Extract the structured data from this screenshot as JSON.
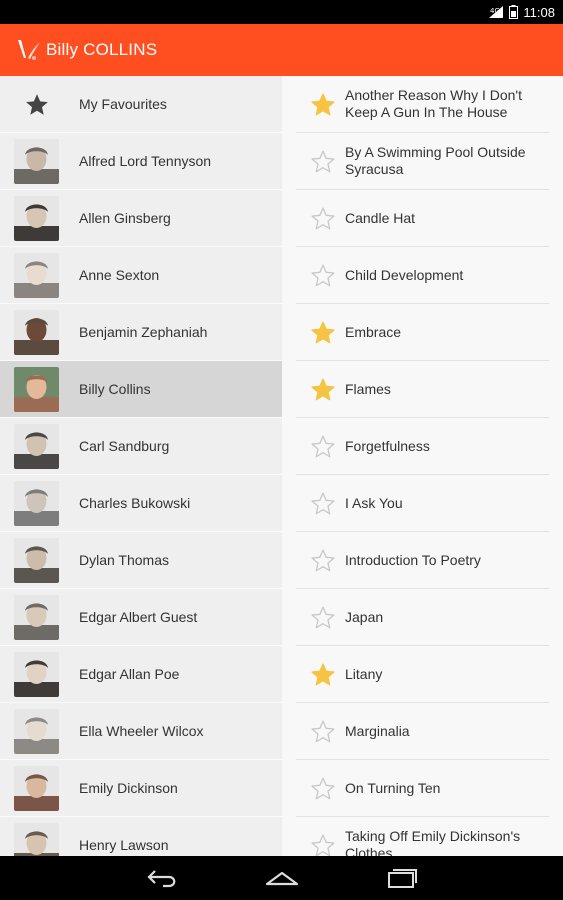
{
  "status_bar": {
    "time": "11:08"
  },
  "app_bar": {
    "title": "Billy COLLINS"
  },
  "favourites": {
    "label": "My Favourites"
  },
  "poets": [
    {
      "name": "Alfred Lord Tennyson",
      "avatar": "portrait-icon"
    },
    {
      "name": "Allen Ginsberg",
      "avatar": "portrait-icon"
    },
    {
      "name": "Anne Sexton",
      "avatar": "portrait-icon"
    },
    {
      "name": "Benjamin Zephaniah",
      "avatar": "portrait-icon"
    },
    {
      "name": "Billy Collins",
      "avatar": "portrait-icon",
      "selected": true
    },
    {
      "name": "Carl Sandburg",
      "avatar": "portrait-icon"
    },
    {
      "name": "Charles Bukowski",
      "avatar": "portrait-icon"
    },
    {
      "name": "Dylan Thomas",
      "avatar": "portrait-icon"
    },
    {
      "name": "Edgar Albert Guest",
      "avatar": "portrait-icon"
    },
    {
      "name": "Edgar Allan Poe",
      "avatar": "portrait-icon"
    },
    {
      "name": "Ella Wheeler Wilcox",
      "avatar": "portrait-icon"
    },
    {
      "name": "Emily Dickinson",
      "avatar": "portrait-icon"
    },
    {
      "name": "Henry Lawson",
      "avatar": "portrait-icon"
    }
  ],
  "poems": [
    {
      "title": "Another Reason Why I Don't Keep A Gun In The House",
      "favourite": true
    },
    {
      "title": "By A Swimming Pool Outside Syracusa",
      "favourite": false
    },
    {
      "title": "Candle Hat",
      "favourite": false
    },
    {
      "title": "Child Development",
      "favourite": false
    },
    {
      "title": "Embrace",
      "favourite": true
    },
    {
      "title": "Flames",
      "favourite": true
    },
    {
      "title": "Forgetfulness",
      "favourite": false
    },
    {
      "title": "I Ask You",
      "favourite": false
    },
    {
      "title": "Introduction To Poetry",
      "favourite": false
    },
    {
      "title": "Japan",
      "favourite": false
    },
    {
      "title": "Litany",
      "favourite": true
    },
    {
      "title": "Marginalia",
      "favourite": false
    },
    {
      "title": "On Turning Ten",
      "favourite": false
    },
    {
      "title": "Taking Off Emily Dickinson's Clothes",
      "favourite": false
    }
  ],
  "colors": {
    "app_bar": "#ff4f20",
    "star_filled": "#f6c342",
    "star_outline": "#c8c8c8",
    "favourites_star": "#444444"
  },
  "icons": {
    "back": "back-icon",
    "home": "home-icon",
    "recents": "recents-icon"
  }
}
